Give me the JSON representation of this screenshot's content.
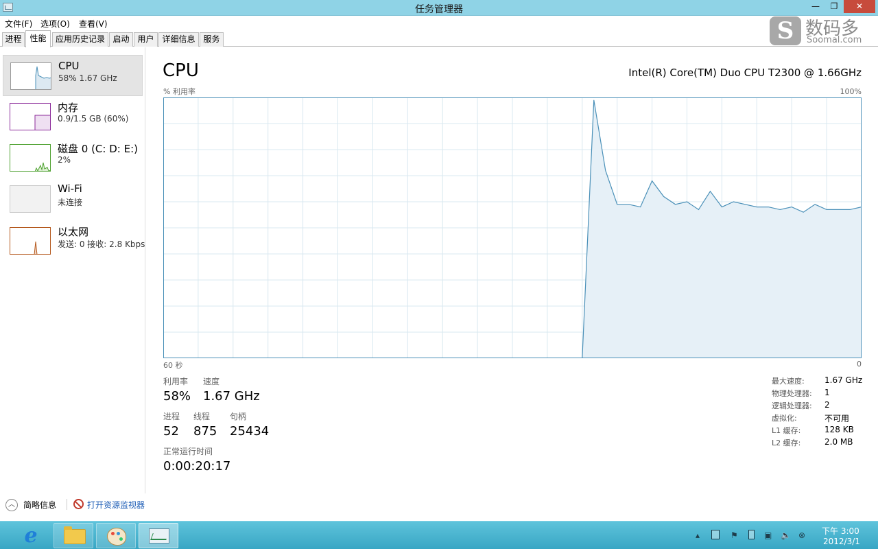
{
  "window": {
    "title": "任务管理器",
    "controls": {
      "minimize": "—",
      "maximize": "❐",
      "close": "✕"
    }
  },
  "watermark": {
    "logo_letter": "S",
    "cn": "数码多",
    "en": "Soomal.com"
  },
  "menu": [
    "文件(F)",
    "选项(O)",
    "查看(V)"
  ],
  "tabs": [
    "进程",
    "性能",
    "应用历史记录",
    "启动",
    "用户",
    "详细信息",
    "服务"
  ],
  "active_tab": "性能",
  "sidebar": [
    {
      "name": "CPU",
      "sub": "58%  1.67 GHz",
      "color": "#4a90b8"
    },
    {
      "name": "内存",
      "sub": "0.9/1.5 GB (60%)",
      "color": "#8b2a9a"
    },
    {
      "name": "磁盘 0 (C: D: E:)",
      "sub": "2%",
      "color": "#4ea130"
    },
    {
      "name": "Wi-Fi",
      "sub": "未连接",
      "color": "#a0a0a0"
    },
    {
      "name": "以太网",
      "sub": "发送: 0  接收: 2.8 Kbps",
      "color": "#b4581c"
    }
  ],
  "main": {
    "title": "CPU",
    "model": "Intel(R) Core(TM) Duo CPU T2300 @ 1.66GHz",
    "graph_label_left": "% 利用率",
    "graph_label_right": "100%",
    "time_left": "60 秒",
    "time_right": "0"
  },
  "stats": {
    "util_label": "利用率",
    "util_value": "58%",
    "speed_label": "速度",
    "speed_value": "1.67 GHz",
    "proc_label": "进程",
    "proc_value": "52",
    "thread_label": "线程",
    "thread_value": "875",
    "handle_label": "句柄",
    "handle_value": "25434",
    "uptime_label": "正常运行时间",
    "uptime_value": "0:00:20:17"
  },
  "specs": [
    {
      "k": "最大速度:",
      "v": "1.67 GHz"
    },
    {
      "k": "物理处理器:",
      "v": "1"
    },
    {
      "k": "逻辑处理器:",
      "v": "2"
    },
    {
      "k": "虚拟化:",
      "v": "不可用"
    },
    {
      "k": "L1 缓存:",
      "v": "128 KB"
    },
    {
      "k": "L2 缓存:",
      "v": "2.0 MB"
    }
  ],
  "footer": {
    "fewer_details": "简略信息",
    "open_resmon": "打开资源监视器"
  },
  "taskbar": {
    "apps": [
      "ie-icon",
      "explorer-icon",
      "paint-icon",
      "task-manager-icon"
    ],
    "clock_time": "下午 3:00",
    "clock_date": "2012/3/1"
  },
  "chart_data": {
    "type": "area",
    "ylim": [
      0,
      100
    ],
    "xlim": [
      60,
      0
    ],
    "x": [
      60,
      24,
      23,
      22,
      21,
      20,
      19,
      18,
      17,
      16,
      15,
      14,
      13,
      12,
      11,
      10,
      9,
      8,
      7,
      6,
      5,
      4,
      3,
      2,
      1,
      0
    ],
    "y": [
      0,
      0,
      99,
      72,
      59,
      59,
      58,
      68,
      62,
      59,
      60,
      57,
      64,
      58,
      60,
      59,
      58,
      58,
      57,
      58,
      56,
      59,
      57,
      57,
      57,
      58
    ],
    "grid": true,
    "color": "#4a90b8"
  }
}
